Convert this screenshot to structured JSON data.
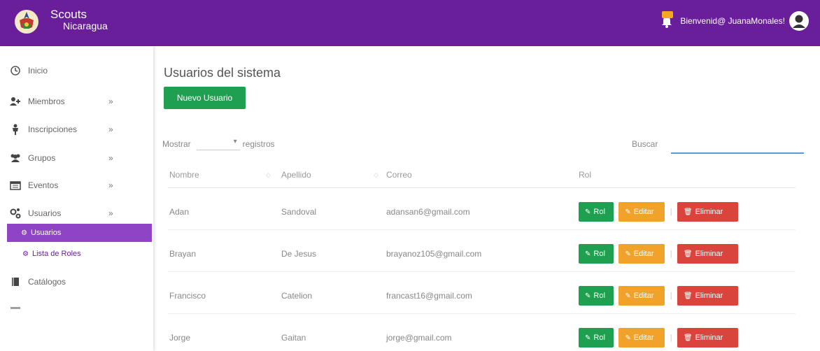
{
  "app": {
    "brand_title": "Scouts",
    "brand_subtitle": "Nicaragua",
    "greeting": "Bienvenid@ JuanaMonales!"
  },
  "sidebar": {
    "items": [
      {
        "label": "Inicio",
        "icon": "clock-icon"
      },
      {
        "label": "Miembros",
        "icon": "user-plus-icon",
        "chevron": "»"
      },
      {
        "label": "Inscripciones",
        "icon": "person-icon",
        "chevron": "»"
      },
      {
        "label": "Grupos",
        "icon": "group-icon",
        "chevron": "»"
      },
      {
        "label": "Eventos",
        "icon": "calendar-icon",
        "chevron": "»"
      },
      {
        "label": "Usuarios",
        "icon": "gears-icon",
        "chevron": "»"
      },
      {
        "label": "Catálogos",
        "icon": "book-icon"
      }
    ],
    "sub_items": [
      {
        "label": "Usuarios",
        "active": true
      },
      {
        "label": "Lista de Roles",
        "active": false
      }
    ]
  },
  "main": {
    "title": "Usuarios del sistema",
    "new_button": "Nuevo Usuario",
    "show_label": "Mostrar",
    "records_label": "registros",
    "search_label": "Buscar",
    "columns": [
      "Nombre",
      "Apellido",
      "Correo",
      "Rol"
    ],
    "rows": [
      {
        "nombre": "Adan",
        "apellido": "Sandoval",
        "correo": "adansan6@gmail.com"
      },
      {
        "nombre": "Brayan",
        "apellido": "De Jesus",
        "correo": "brayanoz105@gmail.com"
      },
      {
        "nombre": "Francisco",
        "apellido": "Catelion",
        "correo": "francast16@gmail.com"
      },
      {
        "nombre": "Jorge",
        "apellido": "Gaitan",
        "correo": "jorge@gmail.com"
      }
    ],
    "actions": {
      "rol": "Rol",
      "edit": "Editar",
      "delete": "Eliminar",
      "separator": "|"
    }
  },
  "colors": {
    "topbar": "#6a1f9a",
    "active_sub": "#8e44c5",
    "rol_button": "#1fa050",
    "edit_button": "#f0a22a",
    "delete_button": "#d9443c",
    "annotation_line": "#2f6fb0"
  }
}
